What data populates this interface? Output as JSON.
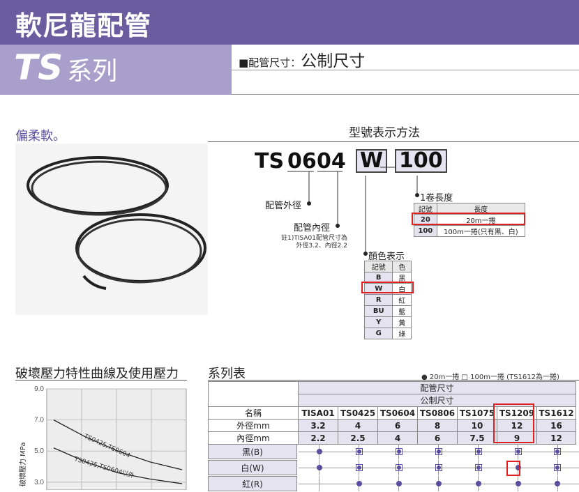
{
  "header": {
    "title": "軟尼龍配管",
    "series_code": "TS",
    "series_word": "系列",
    "spec_prefix": "■配管尺寸：",
    "spec_value": "公制尺寸"
  },
  "photo": {
    "caption": "偏柔軟。"
  },
  "model": {
    "title": "型號表示方法",
    "code_ts": "TS",
    "code_06": "06",
    "code_04": "04",
    "code_w": "W",
    "code_len": "100",
    "outer_label": "配管外徑",
    "inner_label": "配管內徑",
    "note_line1": "註1)TISA01配管尺寸為",
    "note_line2": "外徑3.2、內徑2.2",
    "length_label": "1卷長度",
    "length_headers": [
      "記號",
      "長度"
    ],
    "length_rows": [
      {
        "code": "20",
        "desc": "20m一捲"
      },
      {
        "code": "100",
        "desc": "100m一捲(只有黑、白)"
      }
    ],
    "color_label": "顏色表示",
    "color_headers": [
      "記號",
      "色"
    ],
    "color_rows": [
      {
        "code": "B",
        "desc": "黑"
      },
      {
        "code": "W",
        "desc": "白"
      },
      {
        "code": "R",
        "desc": "紅"
      },
      {
        "code": "BU",
        "desc": "藍"
      },
      {
        "code": "Y",
        "desc": "黃"
      },
      {
        "code": "G",
        "desc": "綠"
      }
    ]
  },
  "pressure_chart": {
    "title": "破壞壓力特性曲線及使用壓力",
    "ylabel": "破壞壓力 MPa",
    "curve1_label": "TS0425,TS0604",
    "curve2_label": "TS0425,TS0604以外"
  },
  "chart_data": {
    "type": "line",
    "ylabel": "破壞壓力 MPa",
    "yticks": [
      "9.0",
      "7.0",
      "5.0",
      "3.0"
    ],
    "ylim": [
      2.5,
      9.0
    ],
    "series": [
      {
        "name": "TS0425,TS0604",
        "points": [
          [
            0,
            7.0
          ],
          [
            1,
            5.9
          ],
          [
            2,
            5.0
          ],
          [
            3,
            4.3
          ],
          [
            4,
            3.8
          ]
        ]
      },
      {
        "name": "TS0425,TS0604以外",
        "points": [
          [
            0,
            5.2
          ],
          [
            1,
            4.3
          ],
          [
            2,
            3.6
          ],
          [
            3,
            3.2
          ],
          [
            4,
            2.9
          ]
        ]
      }
    ]
  },
  "series_table": {
    "title": "系列表",
    "legend": "● 20m一捲  □ 100m一捲 (TS1612為一捲)",
    "group_header": "配管尺寸",
    "sub_header": "公制尺寸",
    "name_label": "名稱",
    "od_label": "外徑mm",
    "id_label": "內徑mm",
    "models": [
      "TISA01",
      "TS0425",
      "TS0604",
      "TS0806",
      "TS1075",
      "TS1209",
      "TS1612"
    ],
    "od": [
      "3.2",
      "4",
      "6",
      "8",
      "10",
      "12",
      "16"
    ],
    "id": [
      "2.2",
      "2.5",
      "4",
      "6",
      "7.5",
      "9",
      "12"
    ],
    "colors": [
      {
        "label": "黑(B)",
        "marks": [
          "dot",
          "sq",
          "sq",
          "sq",
          "sq",
          "sq",
          "sq"
        ]
      },
      {
        "label": "白(W)",
        "marks": [
          "dot",
          "sq",
          "sq",
          "sq",
          "sq",
          "dot",
          "sq"
        ]
      },
      {
        "label": "紅(R)",
        "marks": [
          "",
          "dot",
          "dot",
          "dot",
          "dot",
          "dot",
          "dot"
        ]
      }
    ]
  }
}
